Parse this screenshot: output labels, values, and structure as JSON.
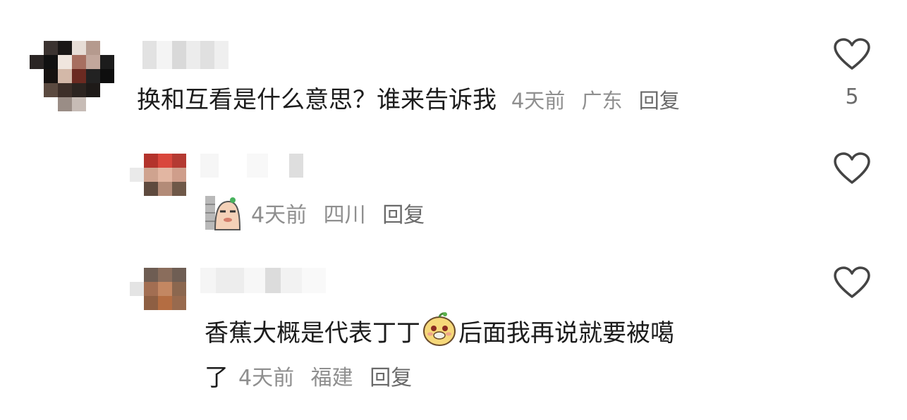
{
  "comments": [
    {
      "text": "换和互看是什么意思？谁来告诉我",
      "meta": {
        "time": "4天前",
        "location": "广东",
        "reply": "回复"
      },
      "like_count": "5",
      "icons": {
        "like": "heart-outline-icon"
      }
    },
    {
      "sticker": "wall-peek-sticker",
      "meta": {
        "time": "4天前",
        "location": "四川",
        "reply": "回复"
      },
      "icons": {
        "like": "heart-outline-icon"
      }
    },
    {
      "text_part1": "香蕉大概是代表丁丁",
      "sticker": "cute-face-emoji",
      "text_part2": "后面我再说就要被噶",
      "text_line2": "了",
      "meta": {
        "time": "4天前",
        "location": "福建",
        "reply": "回复"
      },
      "icons": {
        "like": "heart-outline-icon"
      }
    }
  ],
  "colors": {
    "text": "#1c1c1c",
    "meta": "#8f8f8f",
    "icon": "#444444"
  }
}
